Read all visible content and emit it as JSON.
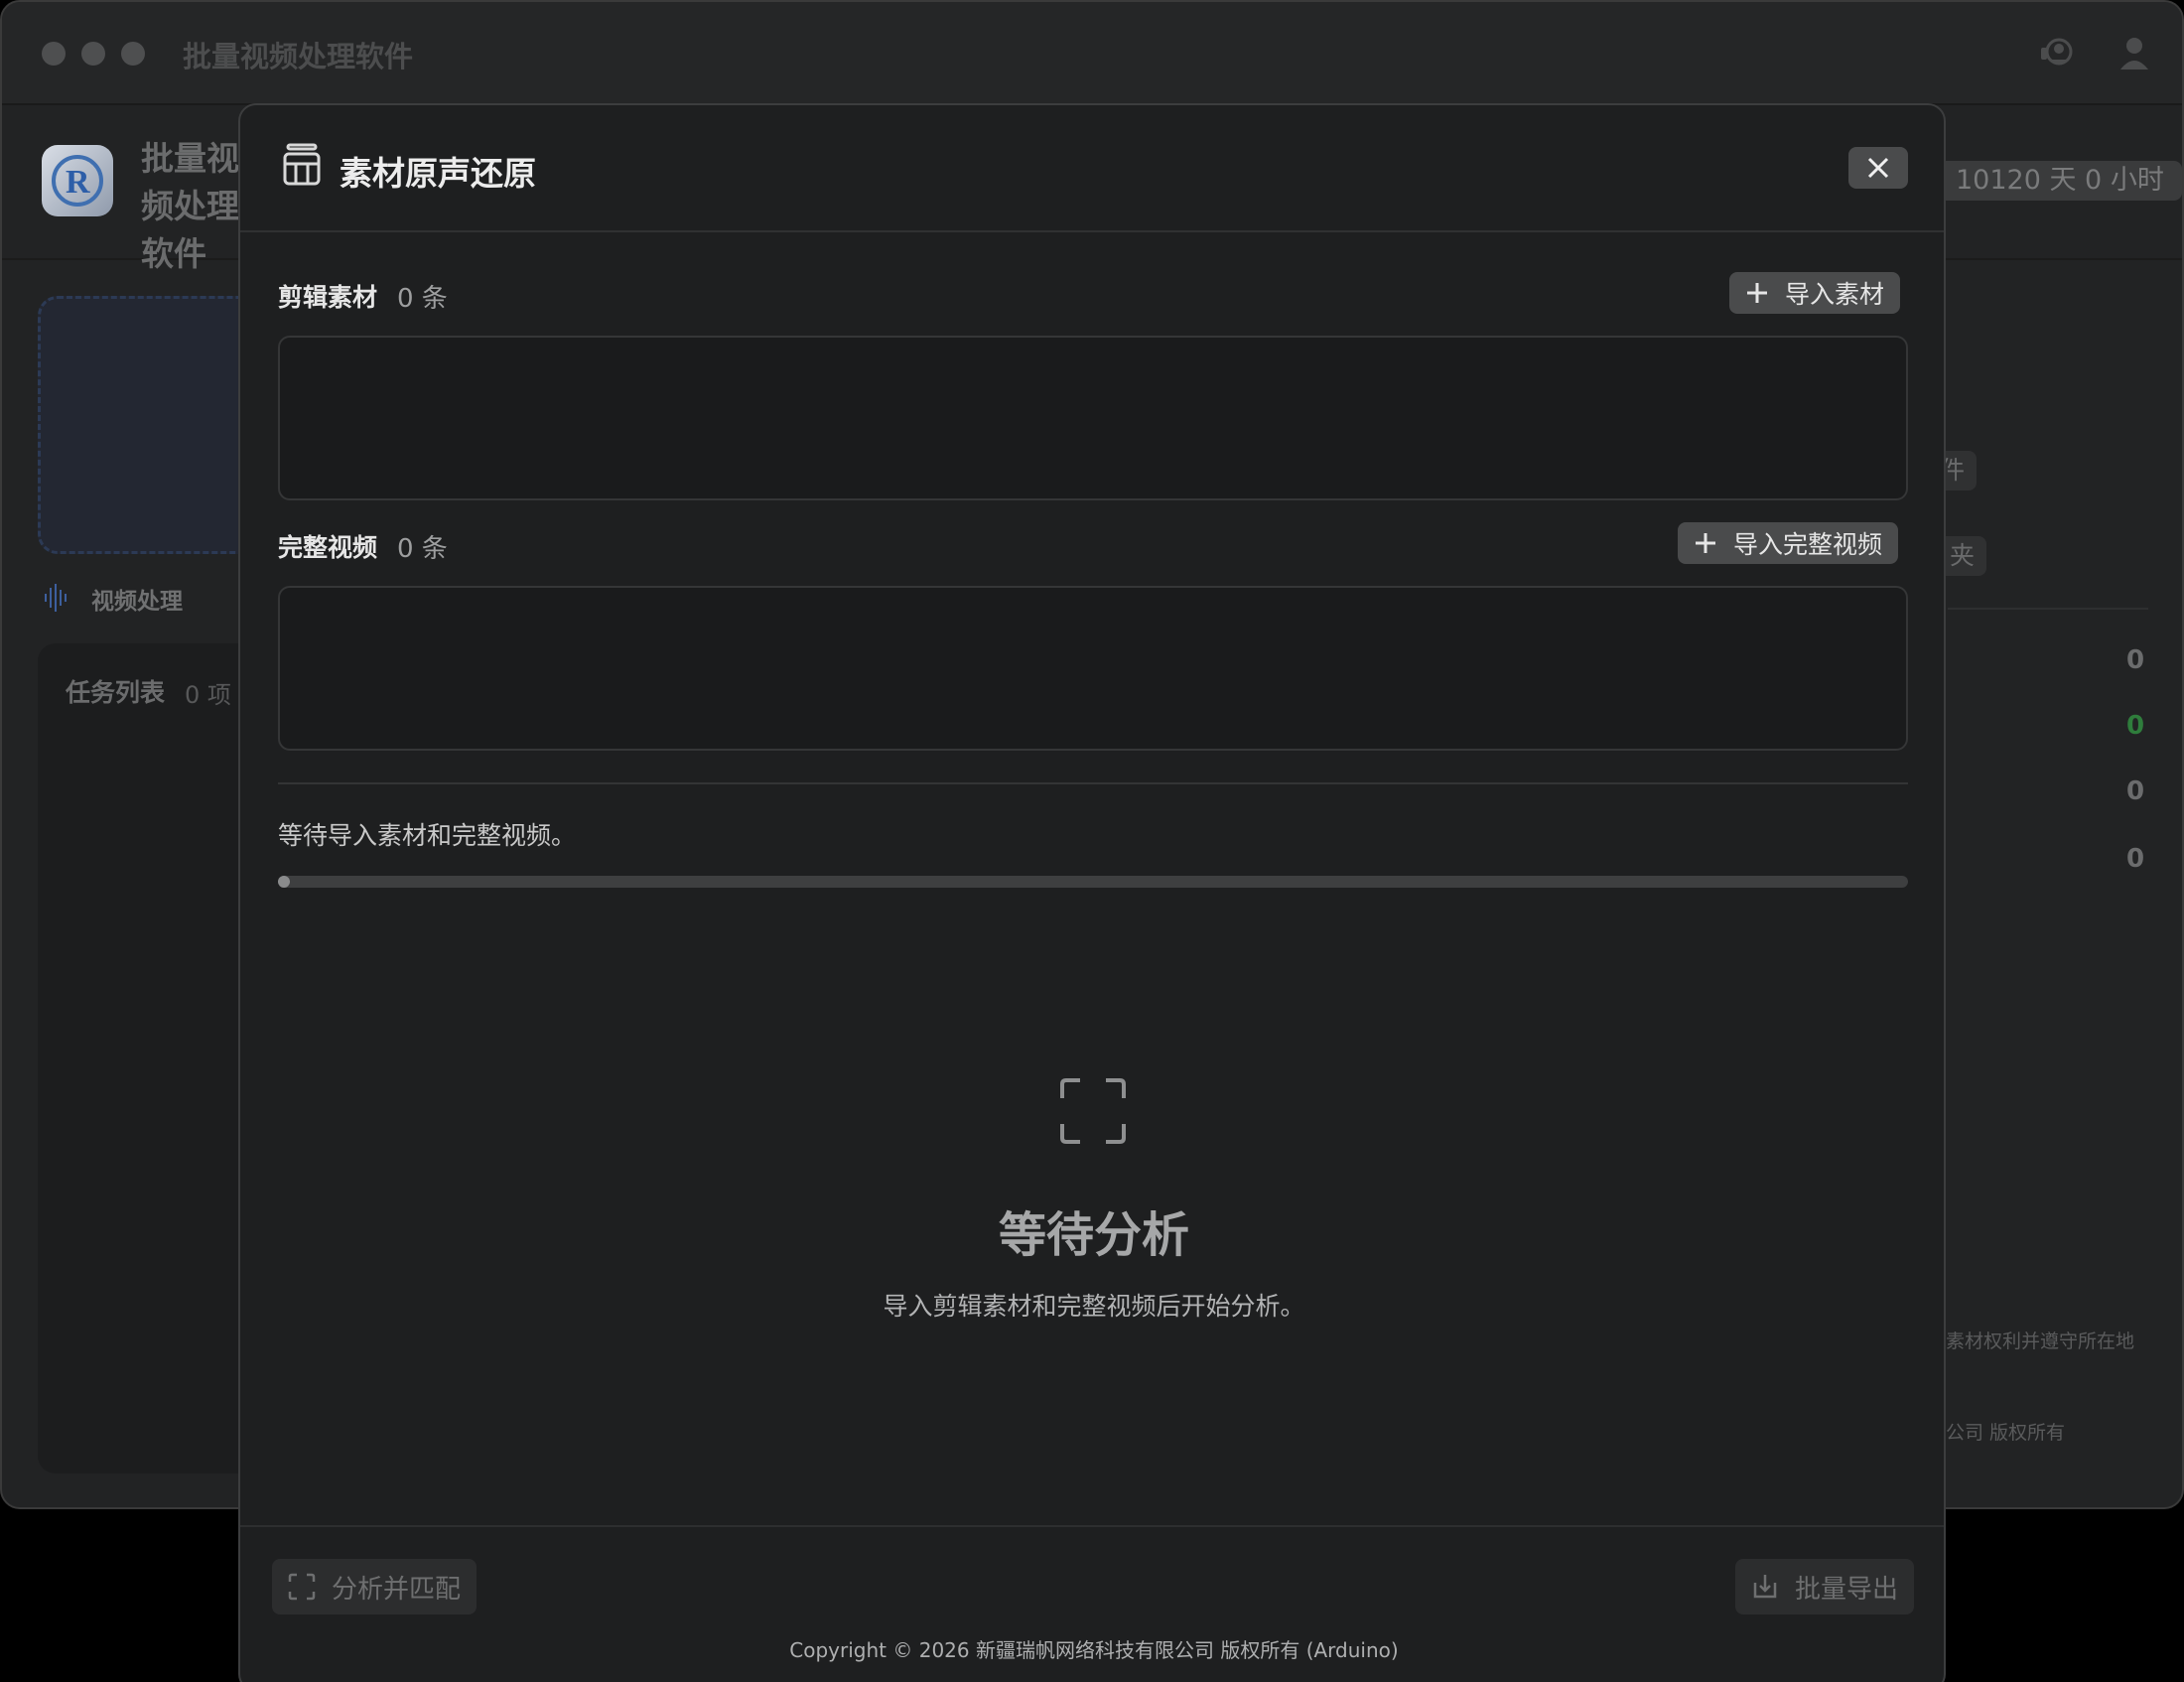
{
  "app": {
    "title": "批量视频处理软件",
    "brand_name": "批量视频处理软件",
    "license_remaining": "10120 天 0 小时",
    "sidebar_label": "视频处理",
    "task_list_title": "任务列表",
    "task_list_count": "0 项",
    "right_button_1": "件",
    "right_button_2": "夹",
    "stats": [
      "0",
      "0",
      "0",
      "0"
    ],
    "note_line_1": "素材权利并遵守所在地",
    "note_line_2": "公司 版权所有"
  },
  "modal": {
    "title": "素材原声还原",
    "clips": {
      "label": "剪辑素材",
      "count": "0 条",
      "import_label": "导入素材"
    },
    "full_video": {
      "label": "完整视频",
      "count": "0 条",
      "import_label": "导入完整视频"
    },
    "status_text": "等待导入素材和完整视频。",
    "progress_percent": 0,
    "empty_state": {
      "title": "等待分析",
      "description": "导入剪辑素材和完整视频后开始分析。"
    },
    "footer": {
      "analyze_label": "分析并匹配",
      "export_label": "批量导出",
      "copyright": "Copyright © 2026 新疆瑞帆网络科技有限公司 版权所有 (Arduino)"
    }
  },
  "icons": {
    "modal": "film-icon",
    "close": "close-icon",
    "add": "plus-icon",
    "empty": "scan-frame-icon",
    "analyze": "scan-frame-icon",
    "export": "export-icon",
    "support": "support-icon",
    "user": "user-icon",
    "sidebar": "waveform-icon"
  },
  "colors": {
    "accent_green": "#2f7d3c",
    "modal_bg": "#1e1f20",
    "button_bg": "#4a4b4c"
  }
}
